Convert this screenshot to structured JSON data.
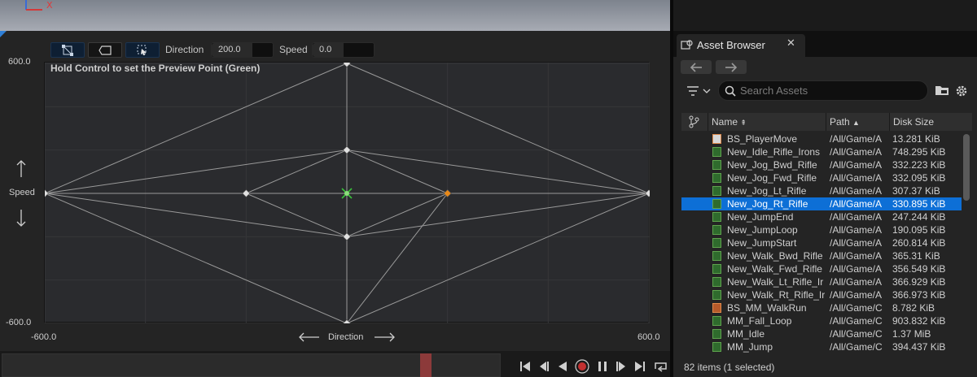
{
  "viewport": {
    "axis_x_label": "X"
  },
  "toolbar": {
    "direction_label": "Direction",
    "direction_value": "200.0",
    "speed_label": "Speed",
    "speed_value": "0.0"
  },
  "blend_space": {
    "hint": "Hold Control to set the Preview Point (Green)",
    "y_max_label": "600.0",
    "y_min_label": "-600.0",
    "x_min_label": "-600.0",
    "x_max_label": "600.0",
    "y_axis_label": "Speed",
    "x_axis_label": "Direction",
    "x_range": [
      -600,
      600
    ],
    "y_range": [
      -600,
      600
    ],
    "samples": [
      {
        "x": 0,
        "y": 600
      },
      {
        "x": -600,
        "y": 0
      },
      {
        "x": -200,
        "y": 0
      },
      {
        "x": 200,
        "y": 0
      },
      {
        "x": 600,
        "y": 0
      },
      {
        "x": 0,
        "y": 200
      },
      {
        "x": 0,
        "y": -200
      },
      {
        "x": 0,
        "y": -600
      }
    ],
    "selected_sample": {
      "x": 200,
      "y": 0
    },
    "preview_point": {
      "x": 0,
      "y": 0
    },
    "colors": {
      "grid_bg": "#2a2b2e",
      "edge": "#9a9a9a",
      "selected": "#e8891a",
      "preview": "#39c23a"
    }
  },
  "asset_browser": {
    "tab_title": "Asset Browser",
    "search_placeholder": "Search Assets",
    "columns": {
      "name": "Name",
      "path": "Path",
      "size": "Disk Size"
    },
    "rows": [
      {
        "name": "BS_PlayerMove",
        "path": "/All/Game/A",
        "size": "13.281 KiB",
        "type": "bs2"
      },
      {
        "name": "New_Idle_Rifle_Irons",
        "path": "/All/Game/A",
        "size": "748.295 KiB",
        "type": "anim"
      },
      {
        "name": "New_Jog_Bwd_Rifle",
        "path": "/All/Game/A",
        "size": "332.223 KiB",
        "type": "anim"
      },
      {
        "name": "New_Jog_Fwd_Rifle",
        "path": "/All/Game/A",
        "size": "332.095 KiB",
        "type": "anim"
      },
      {
        "name": "New_Jog_Lt_Rifle",
        "path": "/All/Game/A",
        "size": "307.37 KiB",
        "type": "anim"
      },
      {
        "name": "New_Jog_Rt_Rifle",
        "path": "/All/Game/A",
        "size": "330.895 KiB",
        "type": "anim",
        "selected": true
      },
      {
        "name": "New_JumpEnd",
        "path": "/All/Game/A",
        "size": "247.244 KiB",
        "type": "anim"
      },
      {
        "name": "New_JumpLoop",
        "path": "/All/Game/A",
        "size": "190.095 KiB",
        "type": "anim"
      },
      {
        "name": "New_JumpStart",
        "path": "/All/Game/A",
        "size": "260.814 KiB",
        "type": "anim"
      },
      {
        "name": "New_Walk_Bwd_Rifle",
        "path": "/All/Game/A",
        "size": "365.31 KiB",
        "type": "anim"
      },
      {
        "name": "New_Walk_Fwd_Rifle",
        "path": "/All/Game/A",
        "size": "356.549 KiB",
        "type": "anim"
      },
      {
        "name": "New_Walk_Lt_Rifle_Ir",
        "path": "/All/Game/A",
        "size": "366.929 KiB",
        "type": "anim"
      },
      {
        "name": "New_Walk_Rt_Rifle_Ir",
        "path": "/All/Game/A",
        "size": "366.973 KiB",
        "type": "anim"
      },
      {
        "name": "BS_MM_WalkRun",
        "path": "/All/Game/C",
        "size": "8.782 KiB",
        "type": "bs"
      },
      {
        "name": "MM_Fall_Loop",
        "path": "/All/Game/C",
        "size": "903.832 KiB",
        "type": "anim"
      },
      {
        "name": "MM_Idle",
        "path": "/All/Game/C",
        "size": "1.37 MiB",
        "type": "anim"
      },
      {
        "name": "MM_Jump",
        "path": "/All/Game/C",
        "size": "394.437 KiB",
        "type": "anim"
      }
    ],
    "status": "82 items (1 selected)"
  }
}
